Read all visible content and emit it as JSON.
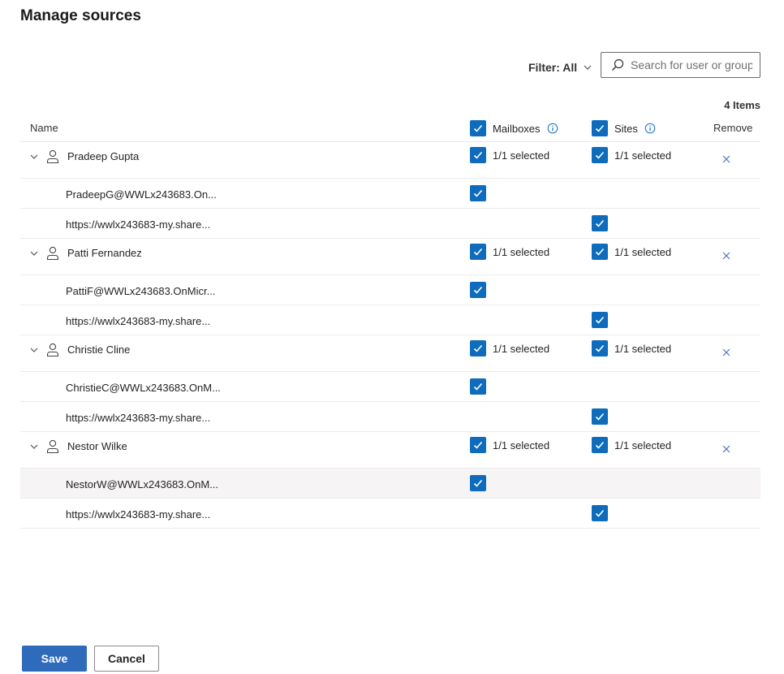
{
  "page": {
    "title": "Manage sources"
  },
  "filter": {
    "label": "Filter: All"
  },
  "search": {
    "placeholder": "Search for user or group"
  },
  "items_count": "4 Items",
  "columns": {
    "name": "Name",
    "mailboxes": "Mailboxes",
    "sites": "Sites",
    "remove": "Remove"
  },
  "users": [
    {
      "name": "Pradeep Gupta",
      "mailbox_status": "1/1 selected",
      "sites_status": "1/1 selected",
      "mailbox": "PradeepG@WWLx243683.On...",
      "site": "https://wwlx243683-my.share..."
    },
    {
      "name": "Patti Fernandez",
      "mailbox_status": "1/1 selected",
      "sites_status": "1/1 selected",
      "mailbox": "PattiF@WWLx243683.OnMicr...",
      "site": "https://wwlx243683-my.share..."
    },
    {
      "name": "Christie Cline",
      "mailbox_status": "1/1 selected",
      "sites_status": "1/1 selected",
      "mailbox": "ChristieC@WWLx243683.OnM...",
      "site": "https://wwlx243683-my.share..."
    },
    {
      "name": "Nestor Wilke",
      "mailbox_status": "1/1 selected",
      "sites_status": "1/1 selected",
      "mailbox": "NestorW@WWLx243683.OnM...",
      "site": "https://wwlx243683-my.share..."
    }
  ],
  "footer": {
    "save_label": "Save",
    "cancel_label": "Cancel"
  },
  "colors": {
    "accent": "#0f6cbd",
    "primary_button": "#2f6bbb",
    "highlight_row": "#f6f4f5"
  },
  "icons": {
    "filter": "chevron-down-icon",
    "search": "search-icon",
    "info": "info-icon",
    "expand": "chevron-down-icon",
    "user": "person-icon",
    "remove": "close-icon",
    "check": "checkmark-icon"
  }
}
